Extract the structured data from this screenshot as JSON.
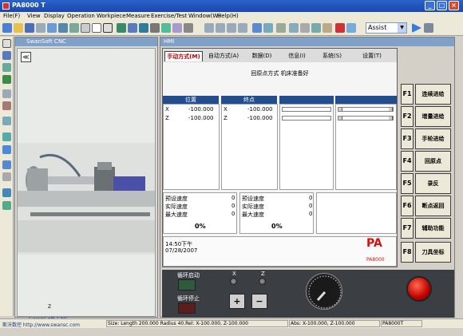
{
  "window": {
    "title": "PA8000 T",
    "minimize": "_",
    "maximize": "□",
    "close": "×"
  },
  "menu": [
    "File(F)",
    "View",
    "Display",
    "Operation",
    "Workpiece",
    "Measure",
    "Exercise/Test",
    "Window(W)",
    "Help(H)"
  ],
  "toolbar": {
    "mode_value": "Assist",
    "dropdown_arrow": "▼"
  },
  "view3d": {
    "title": "SwanSoft CNC",
    "back_label": "≪",
    "footer": "SwanSoft CNC",
    "axis_label": "Z"
  },
  "hmi": {
    "title": "HMI",
    "tabs": [
      "手动方式(M)",
      "自动方式(A)",
      "数据(D)",
      "信息(I)",
      "系统(S)",
      "设置(T)"
    ],
    "status": "回原点方式 机床准备好",
    "pos_header": "位置",
    "end_header": "终点",
    "pos_rows": [
      {
        "axis": "X",
        "value": "-100.000"
      },
      {
        "axis": "Z",
        "value": "-100.000"
      }
    ],
    "end_rows": [
      {
        "axis": "X",
        "value": "-100.000"
      },
      {
        "axis": "Z",
        "value": "-100.000"
      }
    ],
    "feed_left": [
      {
        "label": "预设速度",
        "value": "0"
      },
      {
        "label": "实际速度",
        "value": "0"
      },
      {
        "label": "最大速度",
        "value": "0"
      }
    ],
    "feed_right": [
      {
        "label": "预设速度",
        "value": "0"
      },
      {
        "label": "实际速度",
        "value": "0"
      },
      {
        "label": "最大速度",
        "value": "0"
      }
    ],
    "pct_left": "0%",
    "pct_right": "0%",
    "time": "14:50下午",
    "date": "07/28/2007",
    "logo": "PA",
    "logo_sub": "PA8000"
  },
  "fkeys": [
    {
      "key": "F1",
      "label": "连续进给"
    },
    {
      "key": "F2",
      "label": "增量进给"
    },
    {
      "key": "F3",
      "label": "手轮进给"
    },
    {
      "key": "F4",
      "label": "回原点"
    },
    {
      "key": "F5",
      "label": "录反"
    },
    {
      "key": "F6",
      "label": "断点返回"
    },
    {
      "key": "F7",
      "label": "辅助功能"
    },
    {
      "key": "F8",
      "label": "刀具坐标"
    }
  ],
  "control": {
    "cycle_start": "循环启动",
    "cycle_stop": "循环停止",
    "x_label": "X",
    "z_label": "Z",
    "plus": "+",
    "minus": "−"
  },
  "statusbar": {
    "company": "斯沃数控 http://www.swansc.com",
    "size_info": "Size: Length 200.000 Radius 40.Rel: X-100.000, Z-100.000",
    "abs_info": "Abs: X-100.000, Z-100.000",
    "product": "PA8000T"
  },
  "colors": {
    "title_blue": "#1848b0",
    "header_blue": "#244d8e",
    "active_tab": "#c00000",
    "estop_red": "#c00000",
    "panel_bg": "#3b3f44"
  }
}
